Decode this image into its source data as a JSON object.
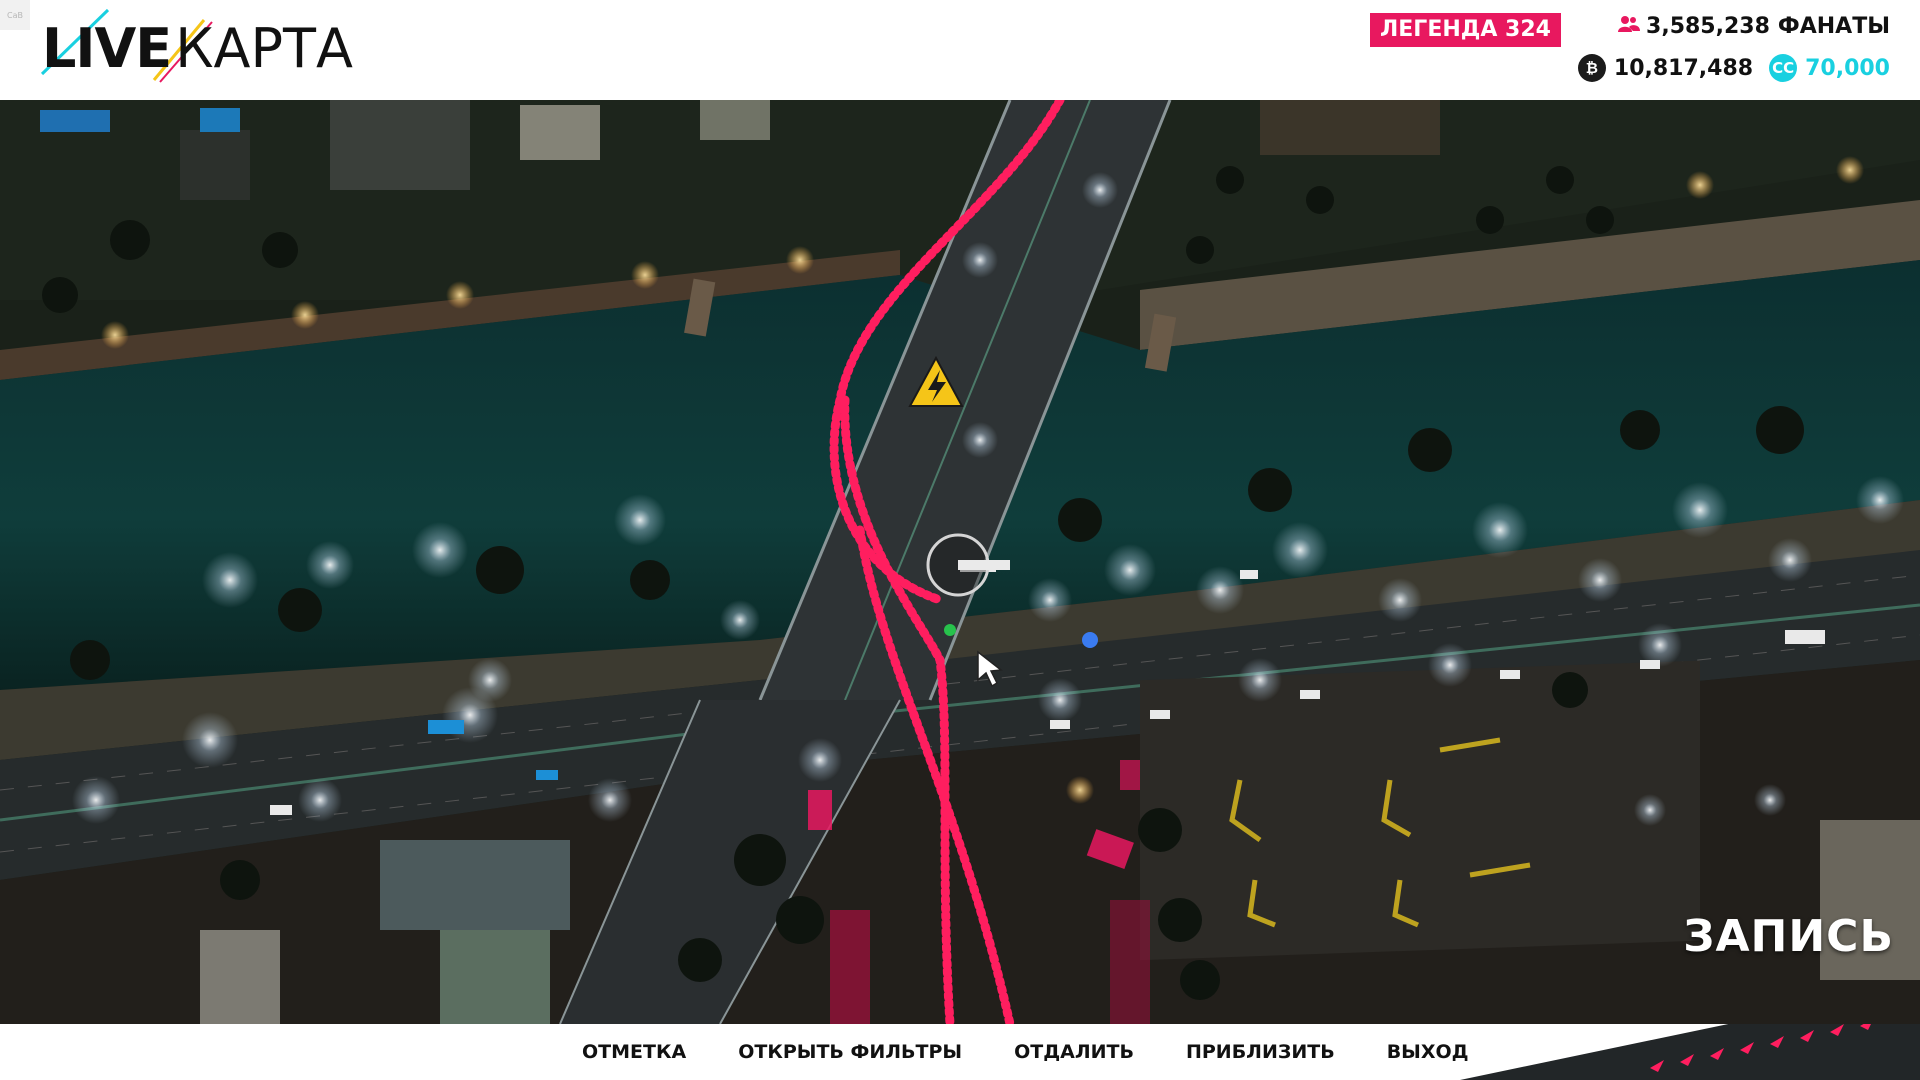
{
  "app": {
    "logo_live": "LIVE",
    "logo_map": "КАРТА",
    "corner_tag": "CaB"
  },
  "player": {
    "legend_label": "ЛЕГЕНДА",
    "legend_level": "324",
    "legend_text": "ЛЕГЕНДА 324",
    "fans_value": "3,585,238",
    "fans_label": "ФАНАТЫ",
    "credits_value": "10,817,488",
    "credits_icon_text": "₿",
    "forzathon_icon_text": "CC",
    "forzathon_value": "70,000"
  },
  "map": {
    "recording_label": "ЗАПИСЬ",
    "icons": [
      "hazard-icon",
      "waypoint-marker-icon",
      "player-location-icon",
      "cursor-icon"
    ]
  },
  "bottom_menu": {
    "items": [
      "ОТМЕТКА",
      "ОТКРЫТЬ ФИЛЬТРЫ",
      "ОТДАЛИТЬ",
      "ПРИБЛИЗИТЬ",
      "ВЫХОД"
    ]
  },
  "colors": {
    "accent": "#e8185f",
    "cyan": "#19d0e0",
    "hazard": "#f5c518",
    "route": "#ff1e5f",
    "water": "#0e3b3a",
    "road": "#2b2f31"
  }
}
